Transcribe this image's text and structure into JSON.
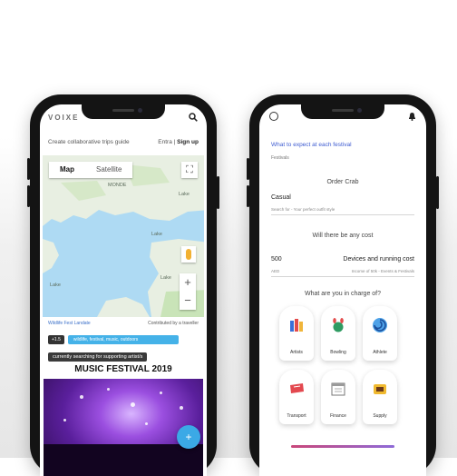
{
  "phone_left": {
    "logo": "VOIXE",
    "subtitle_left": "Create collaborative trips guide",
    "subtitle_right_login": "Entra",
    "subtitle_right_sep": " | ",
    "subtitle_right_signup": "Sign up",
    "map": {
      "tab_map": "Map",
      "tab_satellite": "Satellite",
      "labels": [
        "Lake",
        "Lake",
        "MONDE",
        "Lake",
        "Lake"
      ],
      "zoom_in": "+",
      "zoom_out": "−"
    },
    "map_footer_left": "Wildlife Fest Landate",
    "map_footer_right": "Contributed by a traveller",
    "tag_dark": "+1.5",
    "tag_blue": "wildlife, festival, music, outdoors",
    "search_tag": "currently searching for supporting artist/s",
    "festival_title": "MUSIC FESTIVAL 2019",
    "fab_icon": "+"
  },
  "phone_right": {
    "link": "What to expect at each festival",
    "small": "Festivals",
    "section_order": "Order Crab",
    "order_value": "Casual",
    "order_hint": "Search for - Your perfect outfit style",
    "section_cost": "Will there be any cost",
    "cost_value": "500",
    "cost_hint": "AED",
    "cost_right": "Devices and running cost",
    "cost_right_hint": "Income of 50k - Events & Festivals",
    "section_category": "What are you in charge of?",
    "categories": [
      {
        "label": "Artists",
        "icon": "books-icon"
      },
      {
        "label": "Bowling",
        "icon": "bowling-icon"
      },
      {
        "label": "Athlete",
        "icon": "swirl-icon"
      },
      {
        "label": "Transport",
        "icon": "ticket-icon"
      },
      {
        "label": "Finance",
        "icon": "calendar-icon"
      },
      {
        "label": "Supply",
        "icon": "wallet-icon"
      }
    ],
    "progress": 1.0
  }
}
